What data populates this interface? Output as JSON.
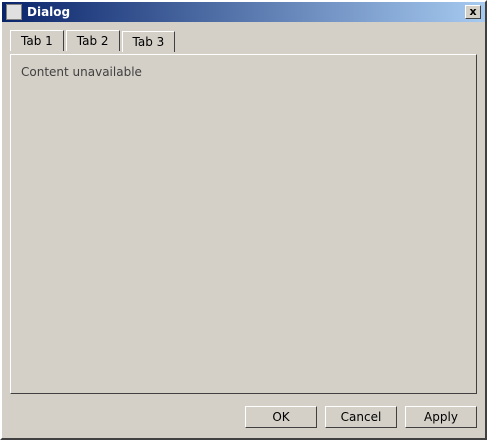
{
  "window": {
    "title": "Dialog",
    "close_label": "x"
  },
  "tabs": [
    {
      "label": "Tab 1"
    },
    {
      "label": "Tab 2"
    },
    {
      "label": "Tab 3"
    }
  ],
  "panel": {
    "text": "Content unavailable"
  },
  "footer": {
    "ok_label": "OK",
    "cancel_label": "Cancel",
    "apply_label": "Apply"
  }
}
